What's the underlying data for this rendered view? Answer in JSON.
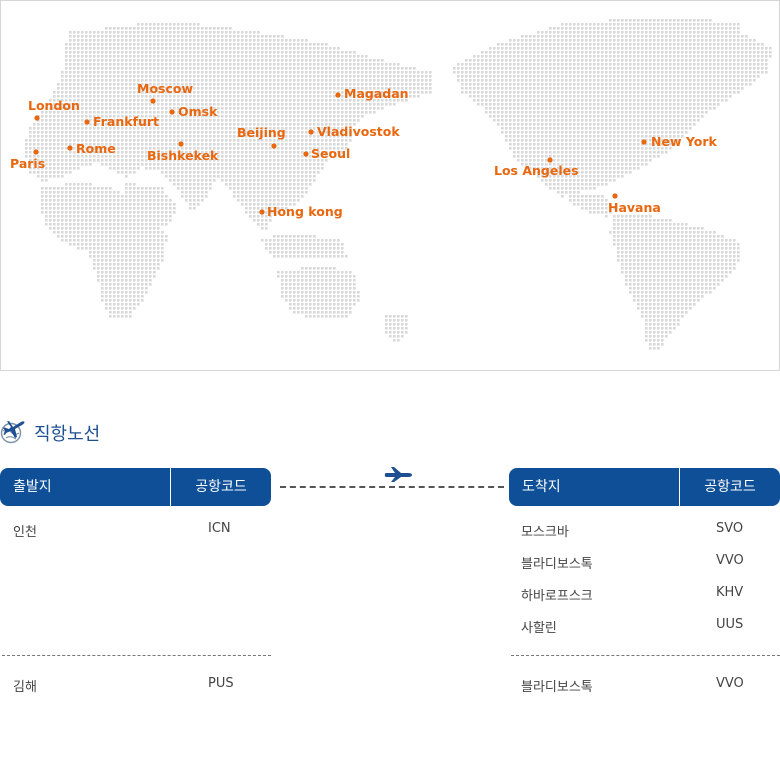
{
  "map": {
    "cities": [
      {
        "name": "London"
      },
      {
        "name": "Paris"
      },
      {
        "name": "Frankfurt"
      },
      {
        "name": "Rome"
      },
      {
        "name": "Moscow"
      },
      {
        "name": "Omsk"
      },
      {
        "name": "Bishkekek"
      },
      {
        "name": "Beijing"
      },
      {
        "name": "Magadan"
      },
      {
        "name": "Vladivostok"
      },
      {
        "name": "Seoul"
      },
      {
        "name": "Hong kong"
      },
      {
        "name": "Los Angeles"
      },
      {
        "name": "New York"
      },
      {
        "name": "Havana"
      }
    ],
    "label_color": "#e8670f",
    "dot_color": "#d8d8d8"
  },
  "routes": {
    "title": "직항노선",
    "departure_header": "출발지",
    "departure_code_header": "공항코드",
    "arrival_header": "도착지",
    "arrival_code_header": "공항코드",
    "groups": [
      {
        "departure": {
          "city": "인천",
          "code": "ICN"
        },
        "arrivals": [
          {
            "city": "모스크바",
            "code": "SVO"
          },
          {
            "city": "블라디보스톡",
            "code": "VVO"
          },
          {
            "city": "하바로프스크",
            "code": "KHV"
          },
          {
            "city": "사할린",
            "code": "UUS"
          }
        ]
      },
      {
        "departure": {
          "city": "김해",
          "code": "PUS"
        },
        "arrivals": [
          {
            "city": "블라디보스톡",
            "code": "VVO"
          }
        ]
      }
    ]
  },
  "colors": {
    "header_bg": "#0e4f98",
    "accent": "#e8670f"
  }
}
